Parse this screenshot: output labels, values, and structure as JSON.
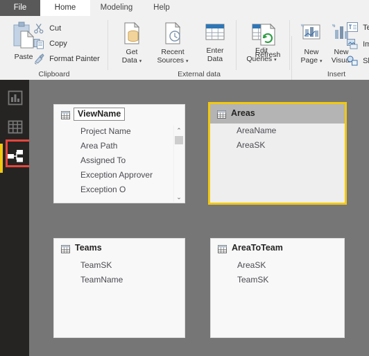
{
  "window": {
    "app": "Power BI Desktop",
    "canvas_bg": "#767676",
    "accent": "#f2c811",
    "annotation_color": "#e8453c"
  },
  "tabs": [
    {
      "label": "File",
      "name": "tab-file"
    },
    {
      "label": "Home",
      "name": "tab-home"
    },
    {
      "label": "Modeling",
      "name": "tab-modeling"
    },
    {
      "label": "Help",
      "name": "tab-help"
    }
  ],
  "ribbon": {
    "groups": [
      {
        "label": "Clipboard",
        "name": "ribbon-group-clipboard"
      },
      {
        "label": "External data",
        "name": "ribbon-group-external-data"
      },
      {
        "label": "Insert",
        "name": "ribbon-group-insert"
      }
    ],
    "clipboard": {
      "paste": "Paste",
      "cut": "Cut",
      "copy": "Copy",
      "format_painter": "Format Painter"
    },
    "external_data": {
      "get_data_l1": "Get",
      "get_data_l2": "Data",
      "recent_sources_l1": "Recent",
      "recent_sources_l2": "Sources",
      "enter_data_l1": "Enter",
      "enter_data_l2": "Data",
      "edit_queries_l1": "Edit",
      "edit_queries_l2": "Queries",
      "refresh": "Refresh"
    },
    "insert": {
      "new_page_l1": "New",
      "new_page_l2": "Page",
      "new_visual_l1": "New",
      "new_visual_l2": "Visual",
      "text_box": "Te",
      "image": "Im",
      "shapes": "Sh"
    },
    "caret": "▾"
  },
  "rail": {
    "items": [
      {
        "label": "Report view",
        "name": "sidebar-item-report-view",
        "selected": false
      },
      {
        "label": "Data view",
        "name": "sidebar-item-data-view",
        "selected": false
      },
      {
        "label": "Model view",
        "name": "sidebar-item-model-view",
        "selected": true
      }
    ]
  },
  "diagram": {
    "tables": [
      {
        "name": "ViewName",
        "selected": false,
        "editing_name": true,
        "scrollbar": true,
        "fields": [
          "Project Name",
          "Area Path",
          "Assigned To",
          "Exception Approver",
          "Exception O"
        ]
      },
      {
        "name": "Areas",
        "selected": true,
        "editing_name": false,
        "scrollbar": false,
        "fields": [
          "AreaName",
          "AreaSK"
        ]
      },
      {
        "name": "Teams",
        "selected": false,
        "editing_name": false,
        "scrollbar": false,
        "fields": [
          "TeamSK",
          "TeamName"
        ]
      },
      {
        "name": "AreaToTeam",
        "selected": false,
        "editing_name": false,
        "scrollbar": false,
        "fields": [
          "AreaSK",
          "TeamSK"
        ]
      }
    ]
  },
  "scroll": {
    "up_arrow": "⌃",
    "down_arrow": "⌄"
  }
}
